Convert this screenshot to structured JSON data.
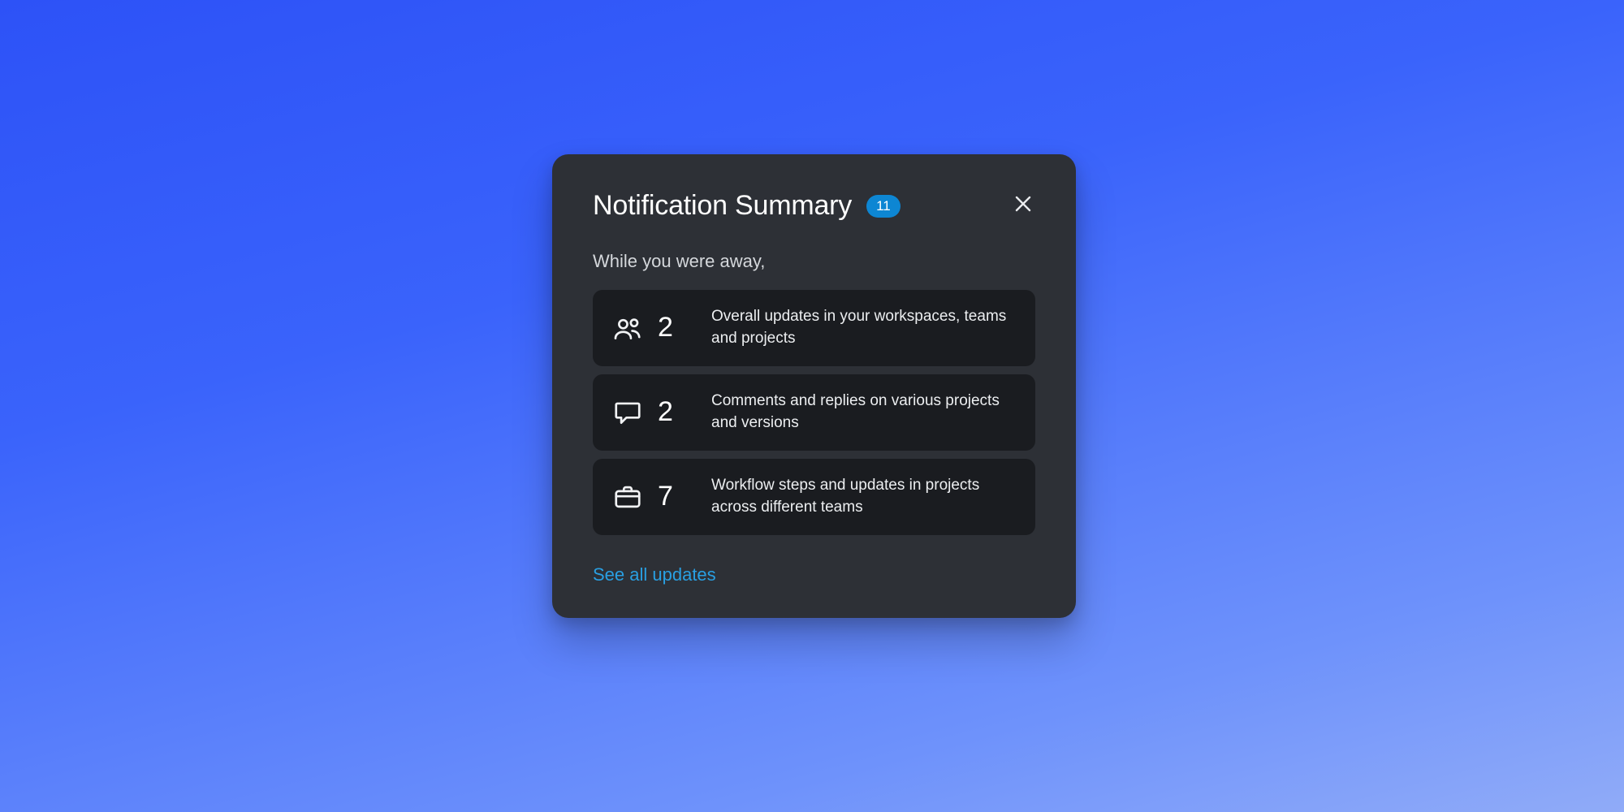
{
  "header": {
    "title": "Notification Summary",
    "badge_count": "11"
  },
  "subtitle": "While you were away,",
  "items": [
    {
      "icon": "users-icon",
      "count": "2",
      "description": "Overall updates in your workspaces, teams and projects"
    },
    {
      "icon": "comment-icon",
      "count": "2",
      "description": "Comments and replies on various projects and versions"
    },
    {
      "icon": "briefcase-icon",
      "count": "7",
      "description": "Workflow steps and updates in projects across different teams"
    }
  ],
  "footer": {
    "see_all_label": "See all updates"
  },
  "colors": {
    "card_bg": "#2d3036",
    "item_bg": "#1a1c20",
    "badge_bg": "#0d86d3",
    "link": "#299fe2"
  }
}
